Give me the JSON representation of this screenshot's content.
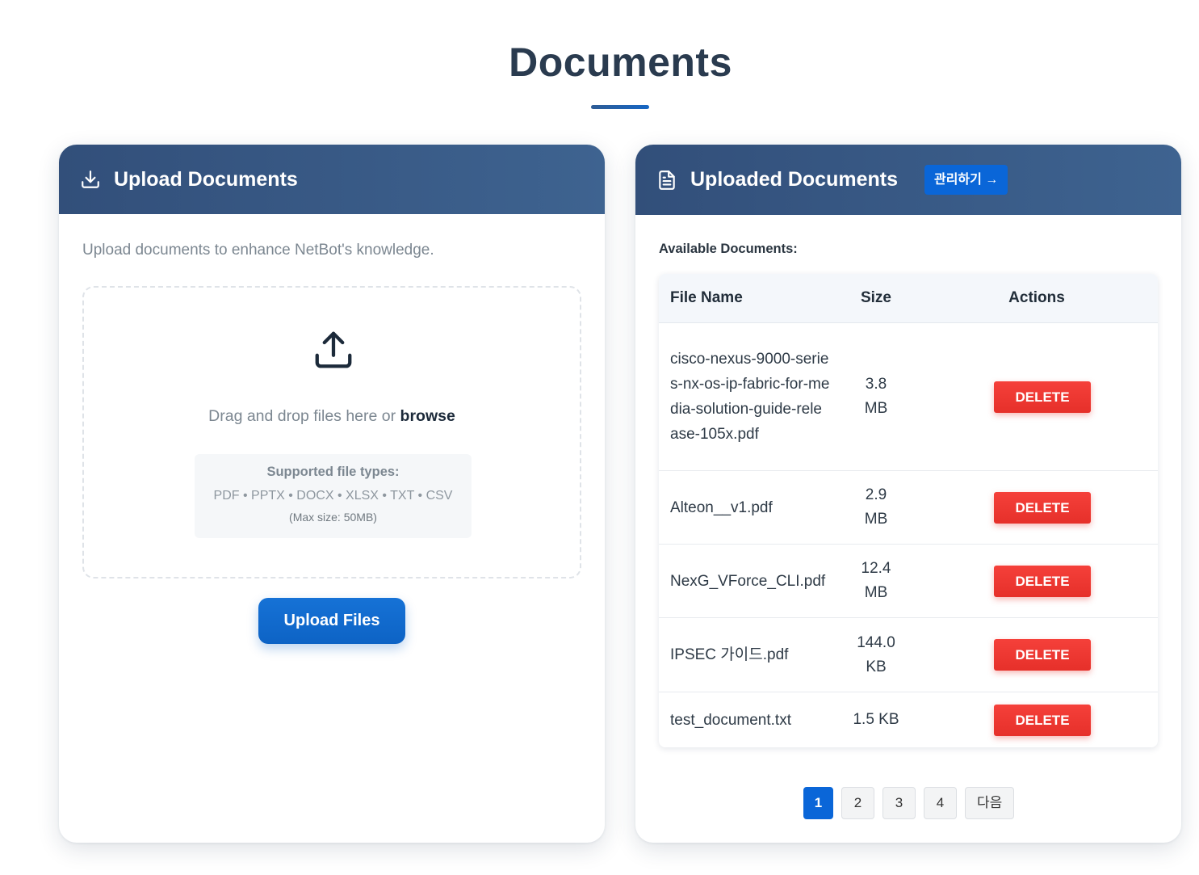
{
  "page": {
    "title": "Documents"
  },
  "upload": {
    "header_title": "Upload Documents",
    "header_icon": "download-tray-icon",
    "intro": "Upload documents to enhance NetBot's knowledge.",
    "dropzone_icon": "upload-tray-icon",
    "drop_text": "Drag and drop files here or",
    "browse_label": "browse",
    "supported_title": "Supported file types:",
    "supported_list": "PDF • PPTX • DOCX • XLSX • TXT • CSV",
    "max_size": "(Max size: 50MB)",
    "upload_button": "Upload Files"
  },
  "uploaded": {
    "header_title": "Uploaded Documents",
    "header_icon": "document-icon",
    "manage_button": "관리하기 →",
    "available_label": "Available Documents:",
    "columns": {
      "name": "File Name",
      "size": "Size",
      "actions": "Actions"
    },
    "rows": [
      {
        "name": "cisco-nexus-9000-series-nx-os-ip-fabric-for-media-solution-guide-release-105x.pdf",
        "size": "3.8 MB",
        "action": "DELETE"
      },
      {
        "name": "Alteon__v1.pdf",
        "size": "2.9 MB",
        "action": "DELETE"
      },
      {
        "name": "NexG_VForce_CLI.pdf",
        "size": "12.4 MB",
        "action": "DELETE"
      },
      {
        "name": "IPSEC 가이드.pdf",
        "size": "144.0 KB",
        "action": "DELETE"
      },
      {
        "name": "test_document.txt",
        "size": "1.5 KB",
        "action": "DELETE"
      }
    ],
    "pagination": {
      "pages": [
        "1",
        "2",
        "3",
        "4"
      ],
      "active": "1",
      "next_label": "다음"
    }
  },
  "colors": {
    "header_bg": "#324f7a",
    "primary": "#0a66d8",
    "danger": "#e6302a"
  }
}
